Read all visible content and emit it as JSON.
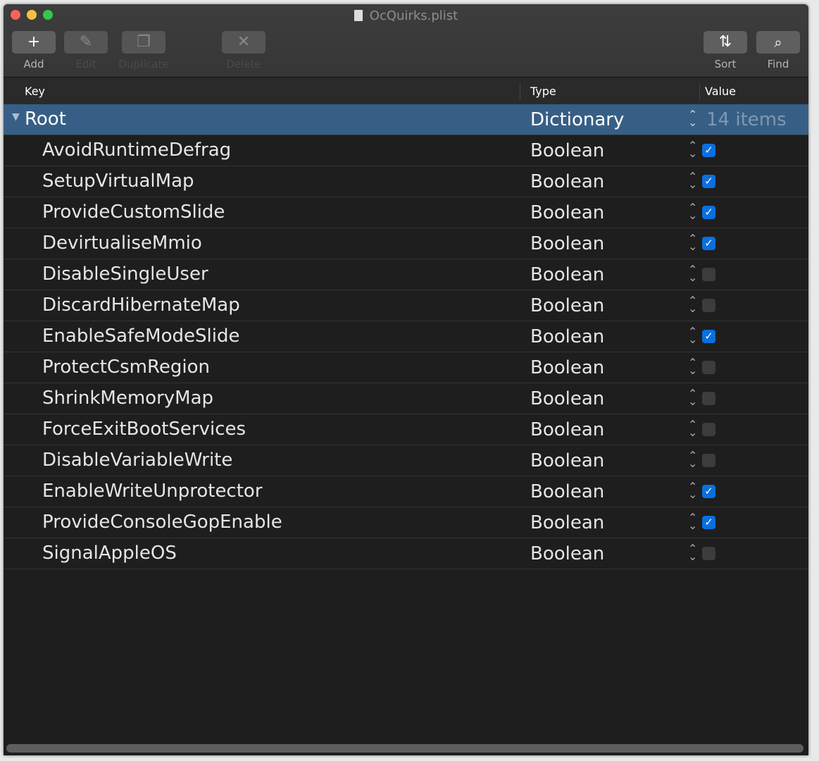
{
  "window": {
    "title": "OcQuirks.plist"
  },
  "toolbar": {
    "add": "Add",
    "edit": "Edit",
    "duplicate": "Duplicate",
    "delete": "Delete",
    "sort": "Sort",
    "find": "Find"
  },
  "columns": {
    "key": "Key",
    "type": "Type",
    "value": "Value"
  },
  "root": {
    "key": "Root",
    "type": "Dictionary",
    "value": "14 items"
  },
  "rows": [
    {
      "key": "AvoidRuntimeDefrag",
      "type": "Boolean",
      "checked": true
    },
    {
      "key": "SetupVirtualMap",
      "type": "Boolean",
      "checked": true
    },
    {
      "key": "ProvideCustomSlide",
      "type": "Boolean",
      "checked": true
    },
    {
      "key": "DevirtualiseMmio",
      "type": "Boolean",
      "checked": true
    },
    {
      "key": "DisableSingleUser",
      "type": "Boolean",
      "checked": false
    },
    {
      "key": "DiscardHibernateMap",
      "type": "Boolean",
      "checked": false
    },
    {
      "key": "EnableSafeModeSlide",
      "type": "Boolean",
      "checked": true
    },
    {
      "key": "ProtectCsmRegion",
      "type": "Boolean",
      "checked": false
    },
    {
      "key": "ShrinkMemoryMap",
      "type": "Boolean",
      "checked": false
    },
    {
      "key": "ForceExitBootServices",
      "type": "Boolean",
      "checked": false
    },
    {
      "key": "DisableVariableWrite",
      "type": "Boolean",
      "checked": false
    },
    {
      "key": "EnableWriteUnprotector",
      "type": "Boolean",
      "checked": true
    },
    {
      "key": "ProvideConsoleGopEnable",
      "type": "Boolean",
      "checked": true
    },
    {
      "key": "SignalAppleOS",
      "type": "Boolean",
      "checked": false
    }
  ],
  "colors": {
    "selection": "#375f85",
    "checkbox_on": "#0a6fe0"
  }
}
